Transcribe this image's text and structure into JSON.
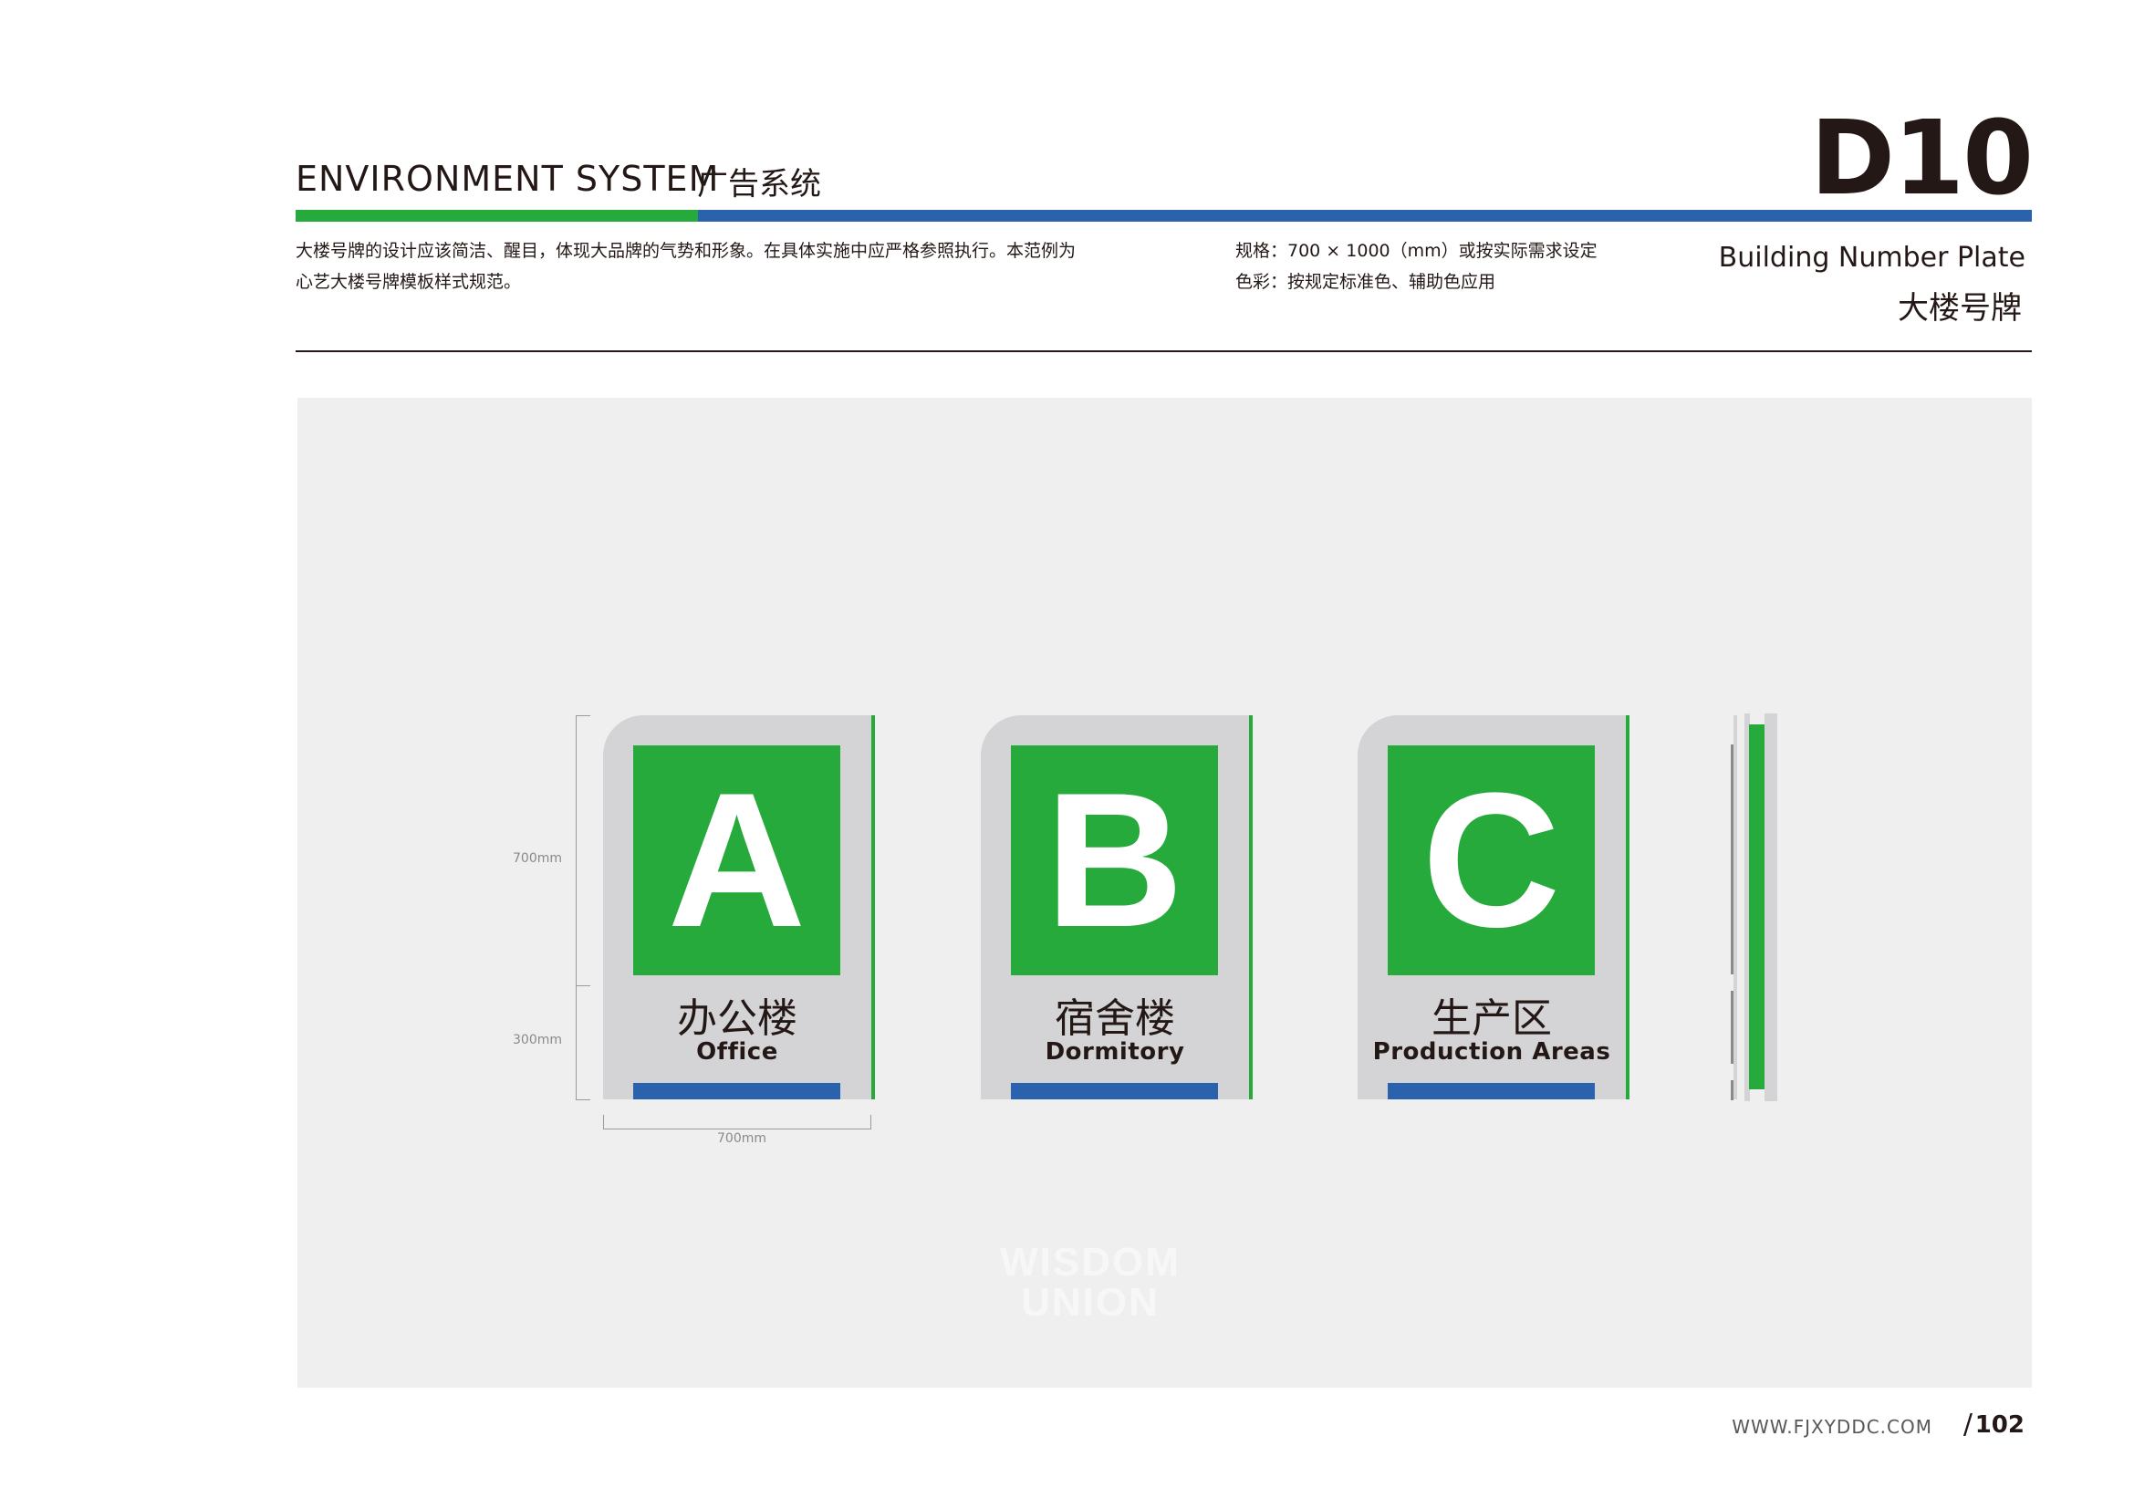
{
  "header": {
    "section_en": "ENVIRONMENT SYSTEM",
    "section_cn": "广告系统",
    "page_code": "D10"
  },
  "description": {
    "line1": "大楼号牌的设计应该简洁、醒目，体现大品牌的气势和形象。在具体实施中应严格参照执行。本范例为",
    "line2": "心艺大楼号牌模板样式规范。"
  },
  "spec": {
    "size": "规格：700 × 1000（mm）或按实际需求设定",
    "color": "色彩：按规定标准色、辅助色应用"
  },
  "title": {
    "en": "Building Number Plate",
    "cn": "大楼号牌"
  },
  "colors": {
    "brand_green": "#27aa3c",
    "brand_blue": "#2a62ad",
    "sign_gray": "#d4d3d5",
    "stage_bg": "#eeefee"
  },
  "dimensions": {
    "height_top": "700mm",
    "height_bottom": "300mm",
    "width": "700mm"
  },
  "signs": [
    {
      "letter": "A",
      "cn": "办公楼",
      "en": "Office"
    },
    {
      "letter": "B",
      "cn": "宿舍楼",
      "en": "Dormitory"
    },
    {
      "letter": "C",
      "cn": "生产区",
      "en": "Production Areas"
    }
  ],
  "watermark": {
    "line1": "WISDOM",
    "line2": "UNION"
  },
  "footer": {
    "website": "WWW.FJXYDDC.COM",
    "slash": "/",
    "page_number": "102"
  }
}
